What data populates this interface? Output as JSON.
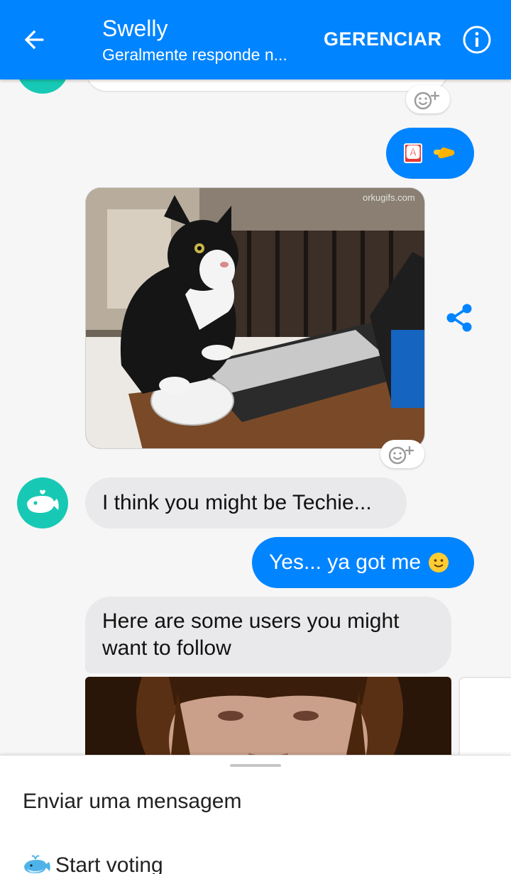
{
  "header": {
    "title": "Swelly",
    "subtitle": "Geralmente responde n...",
    "manage_label": "GERENCIAR",
    "back_icon": "arrow-left-icon",
    "info_icon": "info-icon"
  },
  "colors": {
    "brand_blue": "#0084ff",
    "bot_teal": "#17c9b4",
    "incoming_bubble": "#e9e9eb"
  },
  "messages": {
    "out_1": {
      "emoji_1": "🅰",
      "emoji_2": "👈"
    },
    "image_1": {
      "watermark": "orkugifs.com"
    },
    "in_1": {
      "text": "I think you might be Techie..."
    },
    "out_2": {
      "text": "Yes... ya got me",
      "emoji": "🙂"
    },
    "in_2": {
      "text": "Here are some users you might want to follow"
    }
  },
  "sheet": {
    "item_1": "Enviar uma mensagem",
    "item_2": "Start voting"
  }
}
